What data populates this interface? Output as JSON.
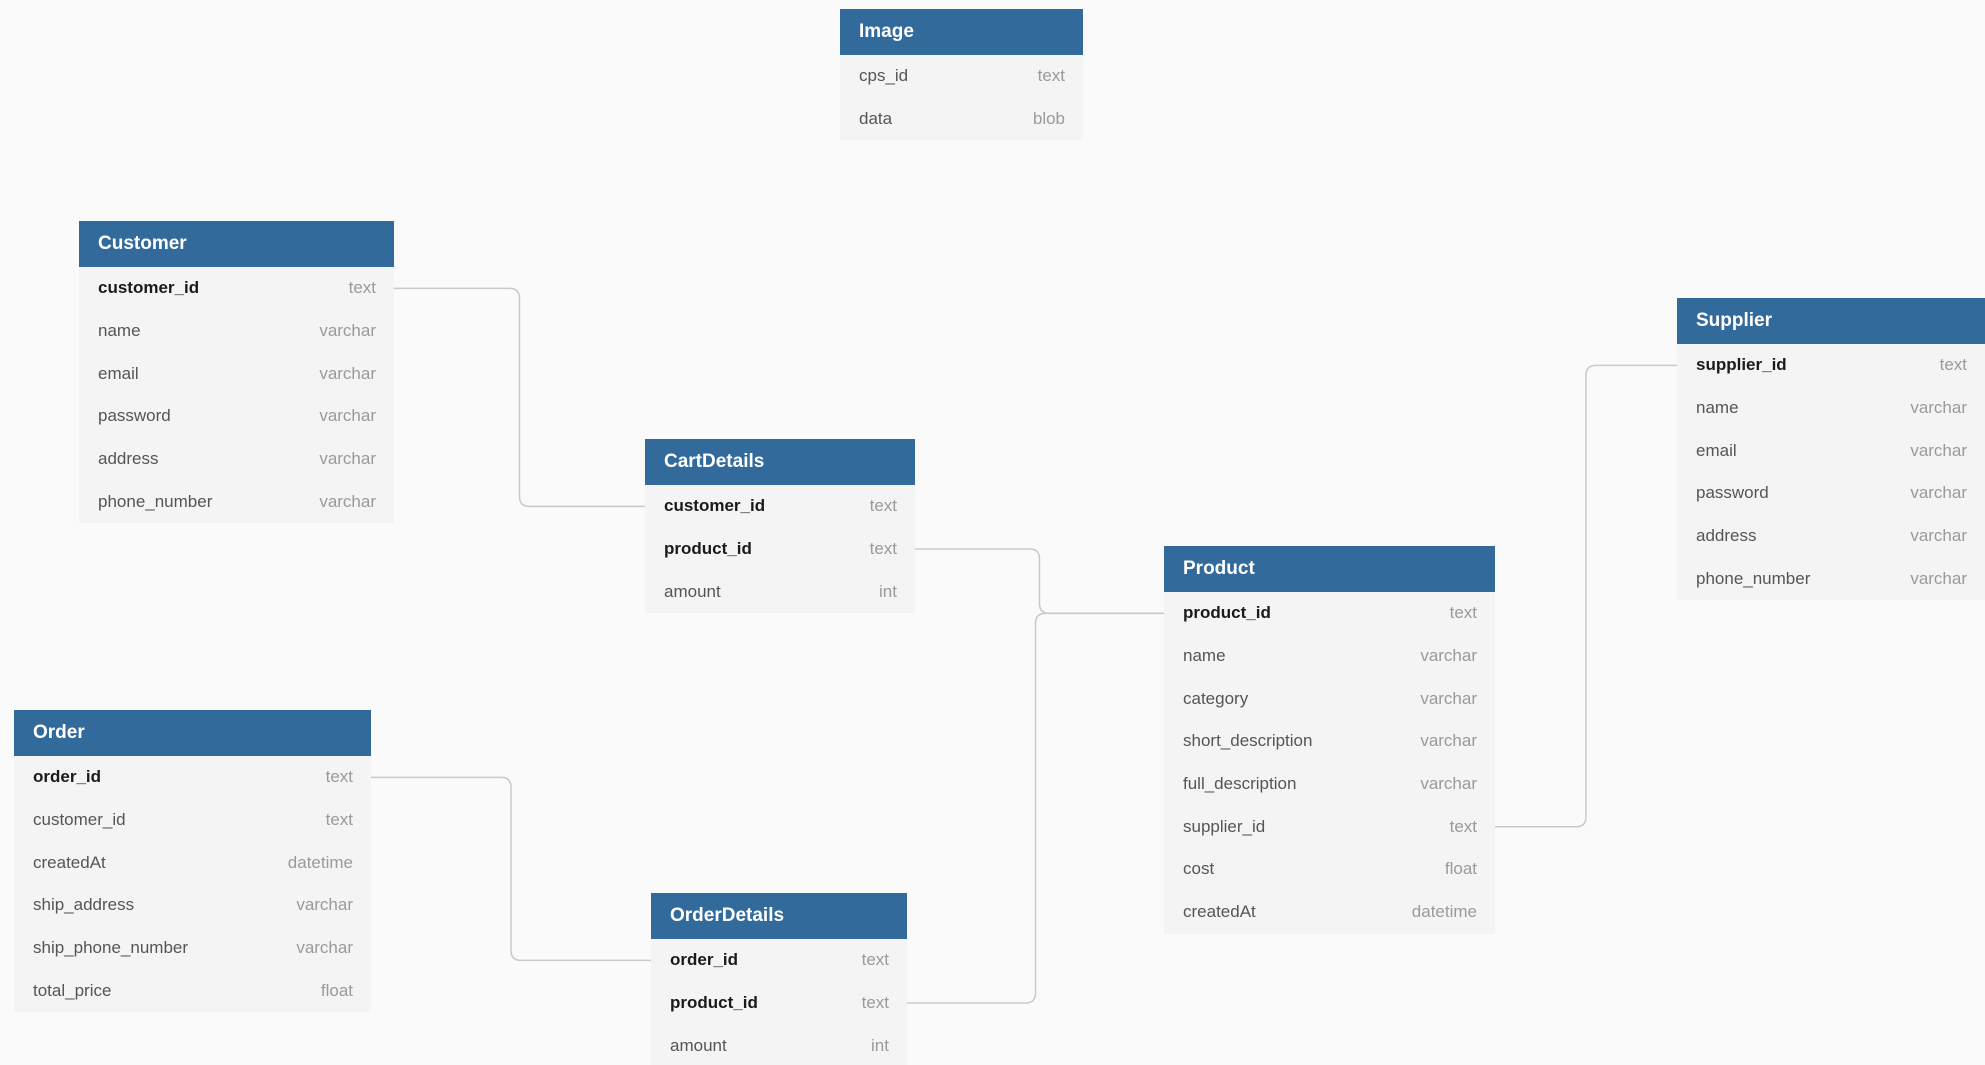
{
  "diagram": {
    "tables": [
      {
        "id": "image",
        "name": "Image",
        "fields": [
          {
            "name": "cps_id",
            "type": "text",
            "key": false
          },
          {
            "name": "data",
            "type": "blob",
            "key": false
          }
        ]
      },
      {
        "id": "customer",
        "name": "Customer",
        "fields": [
          {
            "name": "customer_id",
            "type": "text",
            "key": true
          },
          {
            "name": "name",
            "type": "varchar",
            "key": false
          },
          {
            "name": "email",
            "type": "varchar",
            "key": false
          },
          {
            "name": "password",
            "type": "varchar",
            "key": false
          },
          {
            "name": "address",
            "type": "varchar",
            "key": false
          },
          {
            "name": "phone_number",
            "type": "varchar",
            "key": false
          }
        ]
      },
      {
        "id": "cart-details",
        "name": "CartDetails",
        "fields": [
          {
            "name": "customer_id",
            "type": "text",
            "key": true
          },
          {
            "name": "product_id",
            "type": "text",
            "key": true
          },
          {
            "name": "amount",
            "type": "int",
            "key": false
          }
        ]
      },
      {
        "id": "supplier",
        "name": "Supplier",
        "fields": [
          {
            "name": "supplier_id",
            "type": "text",
            "key": true
          },
          {
            "name": "name",
            "type": "varchar",
            "key": false
          },
          {
            "name": "email",
            "type": "varchar",
            "key": false
          },
          {
            "name": "password",
            "type": "varchar",
            "key": false
          },
          {
            "name": "address",
            "type": "varchar",
            "key": false
          },
          {
            "name": "phone_number",
            "type": "varchar",
            "key": false
          }
        ]
      },
      {
        "id": "product",
        "name": "Product",
        "fields": [
          {
            "name": "product_id",
            "type": "text",
            "key": true
          },
          {
            "name": "name",
            "type": "varchar",
            "key": false
          },
          {
            "name": "category",
            "type": "varchar",
            "key": false
          },
          {
            "name": "short_description",
            "type": "varchar",
            "key": false
          },
          {
            "name": "full_description",
            "type": "varchar",
            "key": false
          },
          {
            "name": "supplier_id",
            "type": "text",
            "key": false
          },
          {
            "name": "cost",
            "type": "float",
            "key": false
          },
          {
            "name": "createdAt",
            "type": "datetime",
            "key": false
          }
        ]
      },
      {
        "id": "order",
        "name": "Order",
        "fields": [
          {
            "name": "order_id",
            "type": "text",
            "key": true
          },
          {
            "name": "customer_id",
            "type": "text",
            "key": false
          },
          {
            "name": "createdAt",
            "type": "datetime",
            "key": false
          },
          {
            "name": "ship_address",
            "type": "varchar",
            "key": false
          },
          {
            "name": "ship_phone_number",
            "type": "varchar",
            "key": false
          },
          {
            "name": "total_price",
            "type": "float",
            "key": false
          }
        ]
      },
      {
        "id": "order-details",
        "name": "OrderDetails",
        "fields": [
          {
            "name": "order_id",
            "type": "text",
            "key": true
          },
          {
            "name": "product_id",
            "type": "text",
            "key": true
          },
          {
            "name": "amount",
            "type": "int",
            "key": false
          }
        ]
      }
    ],
    "relations": [
      {
        "from": "customer.customer_id",
        "to": "cart-details.customer_id"
      },
      {
        "from": "cart-details.product_id",
        "to": "product.product_id"
      },
      {
        "from": "order-details.product_id",
        "to": "product.product_id"
      },
      {
        "from": "order.order_id",
        "to": "order-details.order_id"
      },
      {
        "from": "product.supplier_id",
        "to": "supplier.supplier_id"
      }
    ],
    "colors": {
      "header": "#336a9c",
      "body": "#f4f4f4",
      "background": "#fafafa",
      "connector": "#c9c9c9"
    }
  }
}
